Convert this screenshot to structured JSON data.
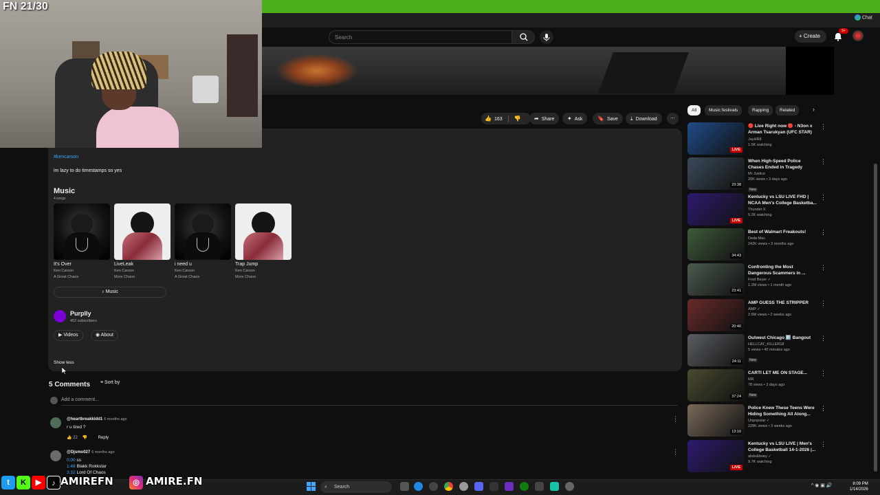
{
  "stream_overlay": {
    "counter": "FN 21/30",
    "social_handles": [
      "AMIREFN",
      "AMIRE.FN"
    ]
  },
  "header": {
    "search_placeholder": "Search",
    "create_label": "Create",
    "notification_count": "9+",
    "chat_label": "Chat"
  },
  "actions": {
    "like_count": "163",
    "share": "Share",
    "ask": "Ask",
    "save": "Save",
    "download": "Download"
  },
  "description": {
    "hashtag": "#kencarson",
    "text": "im lazy to do timestamps so yes",
    "music_heading": "Music",
    "music_count": "4 songs",
    "albums": [
      {
        "title": "It's Over",
        "artist": "Ken Carson",
        "album": "A Great Chaos",
        "art": "dark"
      },
      {
        "title": "LiveLeak",
        "artist": "Ken Carson",
        "album": "More Chaos",
        "art": "light"
      },
      {
        "title": "i need u",
        "artist": "Ken Carson",
        "album": "A Great Chaos",
        "art": "dark"
      },
      {
        "title": "Trap Jump",
        "artist": "Ken Carson",
        "album": "More Chaos",
        "art": "light"
      }
    ],
    "music_button": "Music",
    "channel_name": "Purplly",
    "channel_subs": "452 subscribers",
    "videos_button": "Videos",
    "about_button": "About",
    "show_less": "Show less"
  },
  "comments": {
    "title": "5 Comments",
    "sort_by": "Sort by",
    "add_placeholder": "Add a comment...",
    "items": [
      {
        "author": "@heartbreakkidd1",
        "time": "6 months ago",
        "text": "r u tired ?",
        "likes": "22",
        "reply": "Reply",
        "avatar_color": "#4f6b5a"
      },
      {
        "author": "@Djsmo027",
        "time": "6 months ago",
        "lines": [
          [
            "0:00",
            "ss"
          ],
          [
            "1:48",
            "Blakk Rokkstar"
          ],
          [
            "3:32",
            "Lord Of Chaos"
          ]
        ],
        "avatar_color": "#6a6a6a"
      }
    ]
  },
  "sidebar": {
    "chips": [
      "All",
      "Music festivals",
      "Rapping",
      "Related"
    ],
    "recommendations": [
      {
        "title": "🔴 Live Right now 🔴 - N3on x Arman Tsarukyan (UFC STAR) ...",
        "channel": "JayHR8",
        "views": "1.5K watching",
        "badge": "",
        "duration": "LIVE",
        "thumb": "#1f4c86"
      },
      {
        "title": "When High-Speed Police Chases Ended in Tragedy",
        "channel": "Mr Justice",
        "views": "20K views • 3 days ago",
        "badge": "New",
        "duration": "23:38",
        "thumb": "#3a4a5a"
      },
      {
        "title": "Kentucky vs LSU LIVE FHD | NCAA Men's College Basketba...",
        "channel": "Thunder X",
        "views": "5.2K watching",
        "badge": "",
        "duration": "LIVE",
        "thumb": "#2e1a6e"
      },
      {
        "title": "Best of Walmart Freakouts!",
        "channel": "Deda Mac",
        "views": "242K views • 3 months ago",
        "badge": "",
        "duration": "34:43",
        "thumb": "#3e5a3a"
      },
      {
        "title": "Confronting the Most Dangerous Scammers in ...",
        "channel": "Fred Beyer ✓",
        "views": "1.2M views • 1 month ago",
        "badge": "",
        "duration": "23:41",
        "thumb": "#4a5a4e"
      },
      {
        "title": "AMP GUESS THE STRIPPER",
        "channel": "AMP ✓",
        "views": "2.6M views • 2 weeks ago",
        "badge": "",
        "duration": "20:40",
        "thumb": "#6a2a2a"
      },
      {
        "title": "Outwest Chicago 🅿️ Bangout",
        "channel": "HELLCAT_KILLER18",
        "views": "5 views • 40 minutes ago",
        "badge": "New",
        "duration": "24:11",
        "thumb": "#5a5e62"
      },
      {
        "title": "CARTI LET ME ON STAGE...",
        "channel": "MR",
        "views": "78 views • 3 days ago",
        "badge": "New",
        "duration": "37:24",
        "thumb": "#4a4a30"
      },
      {
        "title": "Police Knew These Teens Were Hiding Something All Along...",
        "channel": "Unpopular ✓",
        "views": "228K views • 3 weeks ago",
        "badge": "",
        "duration": "13:10",
        "thumb": "#7a6a5a"
      },
      {
        "title": "Kentucky vs LSU LIVE | Men's College Basketball 14-1-2026 |...",
        "channel": "abdo&boey ✓",
        "views": "9.7K watching",
        "badge": "",
        "duration": "LIVE",
        "thumb": "#2e1a6e"
      }
    ]
  },
  "taskbar": {
    "search_label": "Search",
    "time": "8:09 PM",
    "date": "1/14/2026"
  }
}
